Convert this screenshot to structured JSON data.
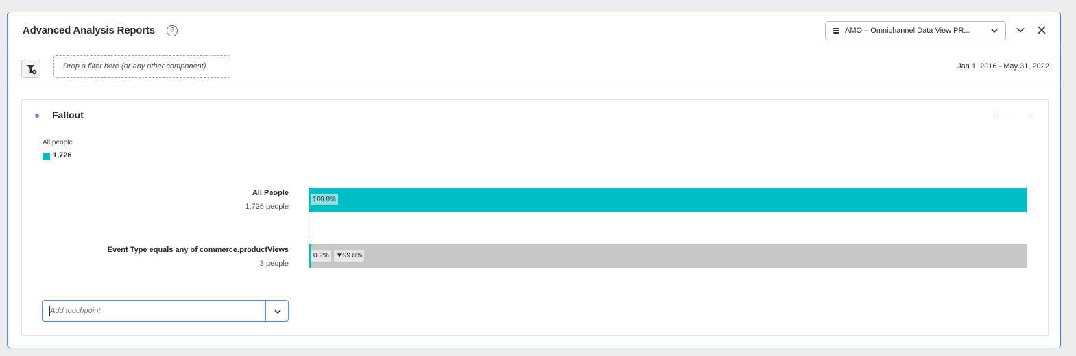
{
  "panel": {
    "title": "Advanced Analysis Reports",
    "help_icon": "?",
    "data_view": {
      "icon": "database-icon",
      "label": "AMO – Omnichannel Data View PR..."
    },
    "header_icons": [
      "chevron-down-icon",
      "close-icon"
    ]
  },
  "filter_bar": {
    "filter_icon": "filter-add-icon",
    "drop_zone": "Drop a filter here (or any other component)",
    "date_range": "Jan 1, 2016 - May 31, 2022"
  },
  "fallout": {
    "title": "Fallout",
    "legend": {
      "label": "All people",
      "value": "1,726",
      "color": "#00bdc4"
    },
    "steps": [
      {
        "name": "All People",
        "count": "1,726 people",
        "percent": 100.0,
        "percent_label": "100.0%",
        "dropoff_label": ""
      },
      {
        "name": "Event Type equals any of commerce.productViews",
        "count": "3 people",
        "percent": 0.2,
        "percent_label": "0.2%",
        "dropoff_label": "▼99.8%"
      }
    ],
    "add_touchpoint": {
      "placeholder": "Add touchpoint"
    },
    "colors": {
      "fill": "#00bdc4",
      "remainder": "#c7c7c7",
      "accent_dot": "#8a7ae0"
    }
  }
}
